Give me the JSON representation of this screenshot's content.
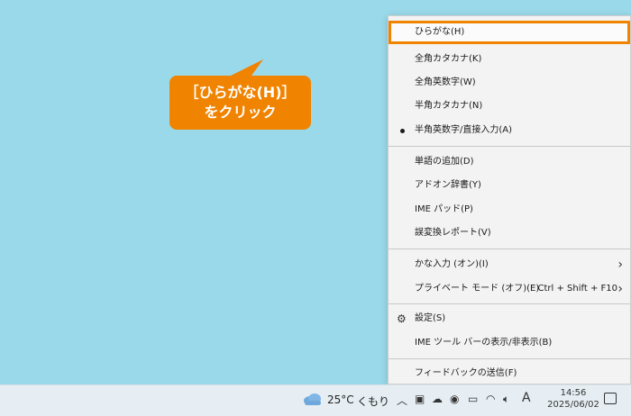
{
  "callout": {
    "line1": "［ひらがな(H)］",
    "line2": "をクリック",
    "color": "#f08300"
  },
  "menu": {
    "items": [
      {
        "label": "ひらがな(H)"
      },
      {
        "label": "全角カタカナ(K)"
      },
      {
        "label": "全角英数字(W)"
      },
      {
        "label": "半角カタカナ(N)"
      },
      {
        "label": "半角英数字/直接入力(A)",
        "bullet": true
      },
      {
        "label": "単語の追加(D)"
      },
      {
        "label": "アドオン辞書(Y)"
      },
      {
        "label": "IME パッド(P)"
      },
      {
        "label": "誤変換レポート(V)"
      },
      {
        "label": "かな入力 (オン)(I)",
        "submenu": true
      },
      {
        "label": "プライベート モード (オフ)(E)",
        "shortcut": "Ctrl + Shift + F10",
        "submenu": true
      },
      {
        "label": "設定(S)",
        "icon": "gear-icon"
      },
      {
        "label": "IME ツール バーの表示/非表示(B)"
      },
      {
        "label": "フィードバックの送信(F)"
      }
    ]
  },
  "taskbar": {
    "weather_temp": "25°C",
    "weather_desc": "くもり",
    "ime_mode": "A",
    "time": "14:56",
    "date": "2025/06/02"
  }
}
